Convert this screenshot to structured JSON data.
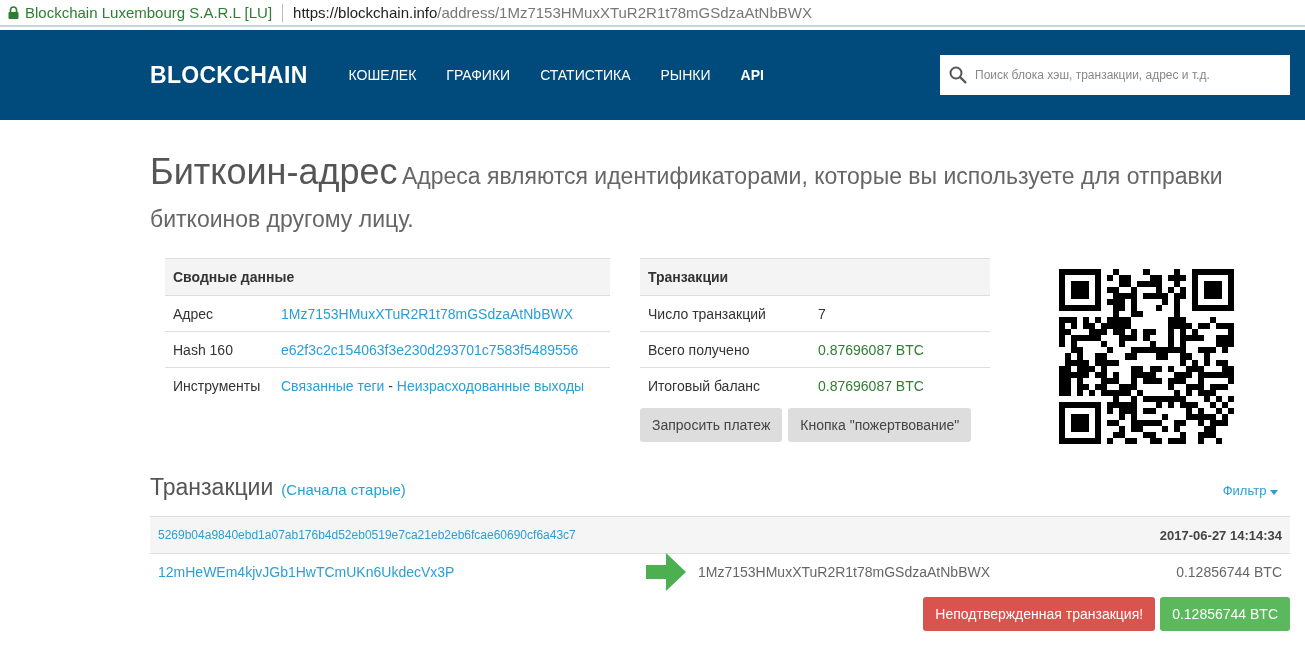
{
  "browser": {
    "site_identity": "Blockchain Luxembourg S.A.R.L [LU]",
    "url_host": "https://blockchain.info",
    "url_path": "/address/1Mz7153HMuxXTuR2R1t78mGSdzaAtNbBWX"
  },
  "nav": {
    "logo": "BLOCKCHAIN",
    "items": [
      {
        "label": "КОШЕЛЕК",
        "emphasized": false
      },
      {
        "label": "ГРАФИКИ",
        "emphasized": false
      },
      {
        "label": "СТАТИСТИКА",
        "emphasized": false
      },
      {
        "label": "РЫНКИ",
        "emphasized": false
      },
      {
        "label": "API",
        "emphasized": true
      }
    ],
    "search": {
      "placeholder": "Поиск блока хэш, транзакции, адрес и т.д."
    }
  },
  "heading": {
    "title": "Биткоин-адрес",
    "subtitle": "Адреса являются идентификаторами, которые вы используете для отправки биткоинов другому лицу."
  },
  "summary": {
    "title": "Сводные данные",
    "rows": [
      {
        "label": "Адрес",
        "parts": [
          {
            "kind": "link",
            "text": "1Mz7153HMuxXTuR2R1t78mGSdzaAtNbBWX"
          }
        ]
      },
      {
        "label": "Hash 160",
        "parts": [
          {
            "kind": "link",
            "text": "e62f3c2c154063f3e230d293701c7583f5489556"
          }
        ]
      },
      {
        "label": "Инструменты",
        "parts": [
          {
            "kind": "link",
            "text": "Связанные теги"
          },
          {
            "kind": "text",
            "text": "-"
          },
          {
            "kind": "link",
            "text": "Неизрасходованные выходы"
          }
        ]
      }
    ]
  },
  "totals": {
    "title": "Транзакции",
    "rows": [
      {
        "label": "Число транзакций",
        "value": "7",
        "kind": "plain"
      },
      {
        "label": "Всего получено",
        "value": "0.87696087 BTC",
        "kind": "amount"
      },
      {
        "label": "Итоговый баланс",
        "value": "0.87696087 BTC",
        "kind": "amount"
      }
    ],
    "buttons": [
      "Запросить платеж",
      "Кнопка \"пожертвование\""
    ]
  },
  "transactions": {
    "title": "Транзакции",
    "order_link": "(Сначала старые)",
    "filter": "Фильтр",
    "items": [
      {
        "hash": "5269b04a9840ebd1a07ab176b4d52eb0519e7ca21eb2eb6fcae60690cf6a43c7",
        "time": "2017-06-27 14:14:34",
        "inputs": [
          "12mHeWEm4kjvJGb1HwTCmUKn6UkdecVx3P"
        ],
        "outputs": [
          {
            "address": "1Mz7153HMuxXTuR2R1t78mGSdzaAtNbBWX",
            "amount": "0.12856744 BTC"
          }
        ],
        "status": "Неподтвержденная транзакция!",
        "confirmed": false,
        "total": "0.12856744 BTC"
      }
    ]
  }
}
